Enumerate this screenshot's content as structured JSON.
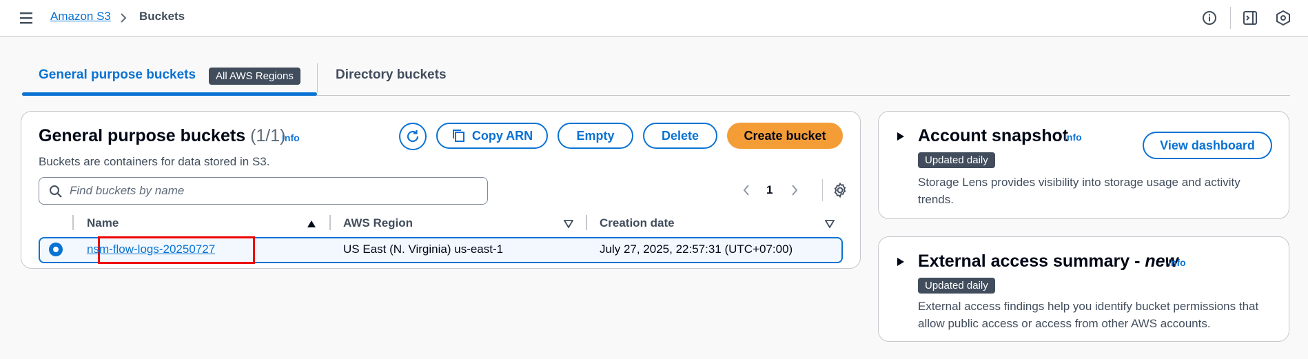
{
  "breadcrumb": {
    "root": "Amazon S3",
    "current": "Buckets"
  },
  "tabs": [
    {
      "label": "General purpose buckets",
      "badge": "All AWS Regions"
    },
    {
      "label": "Directory buckets"
    }
  ],
  "main": {
    "title": "General purpose buckets",
    "count": "(1/1)",
    "info": "Info",
    "description": "Buckets are containers for data stored in S3.",
    "buttons": {
      "copy_arn": "Copy ARN",
      "empty": "Empty",
      "delete": "Delete",
      "create": "Create bucket"
    },
    "search": {
      "placeholder": "Find buckets by name",
      "value": ""
    },
    "pagination": {
      "current_page": "1"
    },
    "columns": [
      "Name",
      "AWS Region",
      "Creation date"
    ],
    "rows": [
      {
        "name": "nsm-flow-logs-20250727",
        "region": "US East (N. Virginia) us-east-1",
        "created": "July 27, 2025, 22:57:31 (UTC+07:00)"
      }
    ]
  },
  "snapshot": {
    "title": "Account snapshot",
    "info": "Info",
    "badge": "Updated daily",
    "description": "Storage Lens provides visibility into storage usage and activity trends.",
    "button": "View dashboard"
  },
  "external": {
    "title_main": "External access summary - ",
    "title_new": "new",
    "info": "Info",
    "badge": "Updated daily",
    "description": "External access findings help you identify bucket permissions that allow public access or access from other AWS accounts."
  },
  "colors": {
    "link": "#0972d3",
    "primary_button": "#f49d37",
    "badge_bg": "#414d5c",
    "highlight_box": "#ee0000"
  },
  "icons": [
    "menu-icon",
    "chevron-right-icon",
    "info-circle-icon",
    "side-panel-icon",
    "settings-hex-icon",
    "refresh-icon",
    "copy-icon",
    "search-icon",
    "chevron-left-icon",
    "gear-icon",
    "sort-up-icon",
    "sort-down-icon",
    "caret-right-icon"
  ]
}
